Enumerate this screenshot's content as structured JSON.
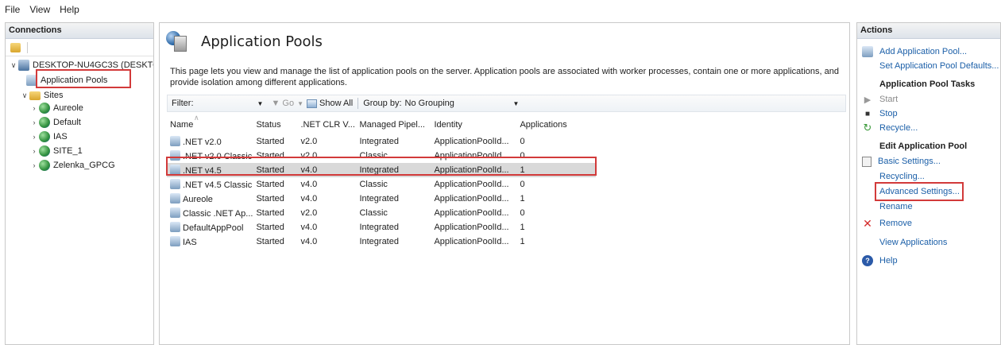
{
  "menu": [
    "File",
    "View",
    "Help"
  ],
  "connections": {
    "header": "Connections",
    "tree": {
      "server": "DESKTOP-NU4GC3S (DESKTO",
      "app_pools": "Application Pools",
      "sites": "Sites",
      "site_list": [
        "Aureole",
        "Default",
        "IAS",
        "SITE_1",
        "Zelenka_GPCG"
      ]
    }
  },
  "main": {
    "title": "Application Pools",
    "description": "This page lets you view and manage the list of application pools on the server. Application pools are associated with worker processes, contain one or more applications, and provide isolation among different applications.",
    "filter": {
      "label": "Filter:",
      "go": "Go",
      "show_all": "Show All",
      "group_by_label": "Group by:",
      "group_by_value": "No Grouping"
    },
    "columns": [
      "Name",
      "Status",
      ".NET CLR V...",
      "Managed Pipel...",
      "Identity",
      "Applications"
    ],
    "rows": [
      [
        ".NET v2.0",
        "Started",
        "v2.0",
        "Integrated",
        "ApplicationPoolId...",
        "0"
      ],
      [
        ".NET v2.0 Classic",
        "Started",
        "v2.0",
        "Classic",
        "ApplicationPoolId...",
        "0"
      ],
      [
        ".NET v4.5",
        "Started",
        "v4.0",
        "Integrated",
        "ApplicationPoolId...",
        "1"
      ],
      [
        ".NET v4.5 Classic",
        "Started",
        "v4.0",
        "Classic",
        "ApplicationPoolId...",
        "0"
      ],
      [
        "Aureole",
        "Started",
        "v4.0",
        "Integrated",
        "ApplicationPoolId...",
        "1"
      ],
      [
        "Classic .NET Ap...",
        "Started",
        "v2.0",
        "Classic",
        "ApplicationPoolId...",
        "0"
      ],
      [
        "DefaultAppPool",
        "Started",
        "v4.0",
        "Integrated",
        "ApplicationPoolId...",
        "1"
      ],
      [
        "IAS",
        "Started",
        "v4.0",
        "Integrated",
        "ApplicationPoolId...",
        "1"
      ]
    ],
    "selected_row": 2
  },
  "actions": {
    "header": "Actions",
    "add_pool": "Add Application Pool...",
    "set_defaults": "Set Application Pool Defaults...",
    "tasks_header": "Application Pool Tasks",
    "start": "Start",
    "stop": "Stop",
    "recycle": "Recycle...",
    "edit_header": "Edit Application Pool",
    "basic_settings": "Basic Settings...",
    "recycling": "Recycling...",
    "advanced_settings": "Advanced Settings...",
    "rename": "Rename",
    "remove": "Remove",
    "view_apps": "View Applications",
    "help": "Help"
  },
  "colors": {
    "link": "#1b5fa8",
    "highlight_box": "#d23a3a",
    "selected_row": "#d9d9d9"
  }
}
